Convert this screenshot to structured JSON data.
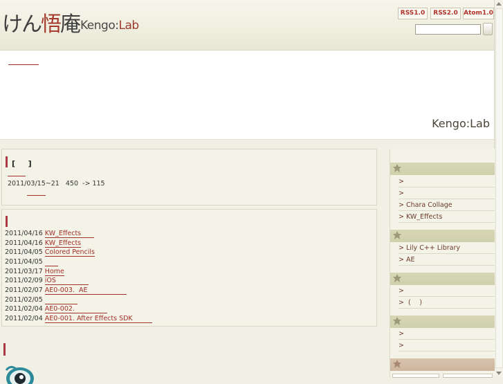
{
  "header": {
    "logo_jp_main": "けん",
    "logo_jp_accent": "悟",
    "logo_jp_tail": "庵",
    "logo_en_main": "Kengo:",
    "logo_en_lab": "Lab",
    "feeds": [
      "RSS1.0",
      "RSS2.0",
      "Atom1.0"
    ],
    "search_value": ""
  },
  "banner": {
    "title": "Kengo:Lab"
  },
  "notice": {
    "heading": "[ 　 ]",
    "text": "2011/03/15~21   450  -> 115"
  },
  "updates": [
    {
      "date": "2011/04/16",
      "title": "KW_Effects　　"
    },
    {
      "date": "2011/04/16",
      "title": "KW_Effects"
    },
    {
      "date": "2011/04/05",
      "title": "Colored Pencils"
    },
    {
      "date": "2011/04/05",
      "title": "　　"
    },
    {
      "date": "2011/03/17",
      "title": "Home"
    },
    {
      "date": "2011/02/09",
      "title": "iOS　　　　　"
    },
    {
      "date": "2011/02/07",
      "title": "AE0-003.  AE　　　　　　"
    },
    {
      "date": "2011/02/05",
      "title": "　　　　　"
    },
    {
      "date": "2011/02/04",
      "title": "AE0-002.　　　　　"
    },
    {
      "date": "2011/02/04",
      "title": "AE0-001. After Effects SDK　　　"
    }
  ],
  "sidebar": {
    "sections": [
      {
        "items": [
          "> ",
          "> ",
          "> Chara Collage",
          "> KW_Effects"
        ]
      },
      {
        "items": [
          "> Lily C++ Library",
          "> AE"
        ]
      },
      {
        "items": [
          "> ",
          ">  (　 )"
        ]
      },
      {
        "items": [
          "> ",
          "> "
        ]
      },
      {
        "items": []
      }
    ]
  },
  "colors": {
    "accent": "#a83a46",
    "link": "#a0302a",
    "sidebar_header": "#d3d4b0",
    "sidebar_header_last": "#d1b9a4"
  }
}
